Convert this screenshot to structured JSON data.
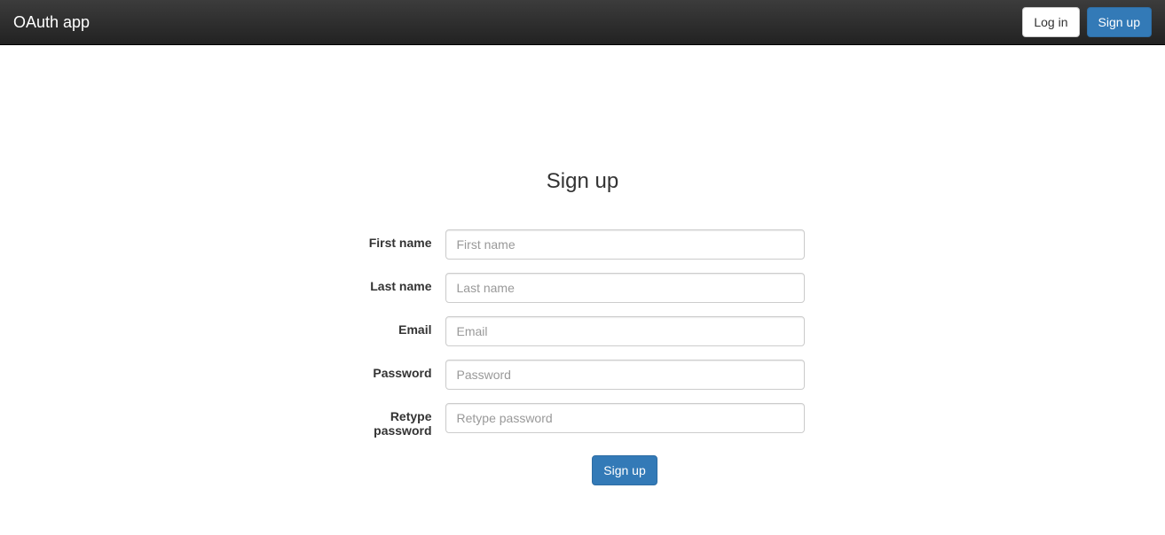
{
  "navbar": {
    "brand": "OAuth app",
    "login_label": "Log in",
    "signup_label": "Sign up"
  },
  "page": {
    "title": "Sign up"
  },
  "form": {
    "first_name": {
      "label": "First name",
      "placeholder": "First name",
      "value": ""
    },
    "last_name": {
      "label": "Last name",
      "placeholder": "Last name",
      "value": ""
    },
    "email": {
      "label": "Email",
      "placeholder": "Email",
      "value": ""
    },
    "password": {
      "label": "Password",
      "placeholder": "Password",
      "value": ""
    },
    "retype_password": {
      "label": "Retype password",
      "placeholder": "Retype password",
      "value": ""
    },
    "submit_label": "Sign up"
  }
}
